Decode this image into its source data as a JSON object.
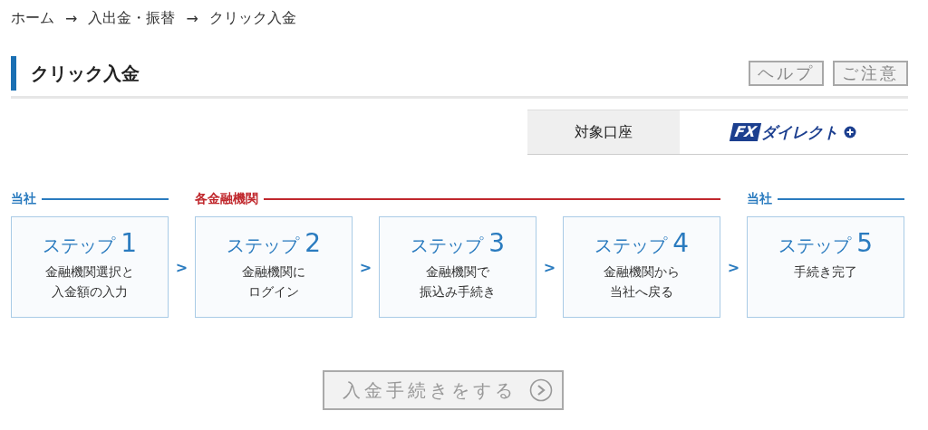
{
  "breadcrumb": [
    {
      "label": "ホーム"
    },
    {
      "label": "入出金・振替"
    },
    {
      "label": "クリック入金"
    }
  ],
  "breadcrumb_separator": "→",
  "page_title": "クリック入金",
  "header_buttons": [
    "ヘルプ",
    "ご注意"
  ],
  "account": {
    "label": "対象口座",
    "logo_mark": "FX",
    "logo_text": "ダイレクト"
  },
  "phases": [
    {
      "label": "当社",
      "color": "#2a7bbf",
      "steps": [
        {
          "title": "ステップ",
          "number": "1",
          "lines": [
            "金融機関選択と",
            "入金額の入力"
          ]
        }
      ]
    },
    {
      "label": "各金融機関",
      "color": "#c0282d",
      "steps": [
        {
          "title": "ステップ",
          "number": "2",
          "lines": [
            "金融機関に",
            "ログイン"
          ]
        },
        {
          "title": "ステップ",
          "number": "3",
          "lines": [
            "金融機関で",
            "振込み手続き"
          ]
        },
        {
          "title": "ステップ",
          "number": "4",
          "lines": [
            "金融機関から",
            "当社へ戻る"
          ]
        }
      ]
    },
    {
      "label": "当社",
      "color": "#2a7bbf",
      "steps": [
        {
          "title": "ステップ",
          "number": "5",
          "lines": [
            "手続き完了"
          ]
        }
      ]
    }
  ],
  "step_arrow": ">",
  "submit": {
    "label": "入金手続きをする",
    "disabled": true
  }
}
